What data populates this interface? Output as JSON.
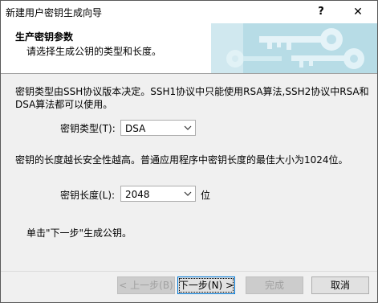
{
  "window": {
    "title": "新建用户密钥生成向导",
    "help_label": "?",
    "close_label": "✕"
  },
  "header": {
    "title": "生产密钥参数",
    "subtitle": "请选择生成公钥的类型和长度。"
  },
  "body": {
    "description_line1": "密钥类型由SSH协议版本决定。SSH1协议中只能使用RSA算法,SSH2协议中RSA和",
    "description_line2": "DSA算法都可以使用。",
    "key_type_label": "密钥类型(T):",
    "key_type_value": "DSA",
    "length_description": "密钥的长度越长安全性越高。普通应用程序中密钥长度的最佳大小为1024位。",
    "key_length_label": "密钥长度(L):",
    "key_length_value": "2048",
    "key_length_unit": "位",
    "next_instruction": "单击\"下一步\"生成公钥。"
  },
  "footer": {
    "back_label": "< 上一步(B)",
    "next_label": "下一步(N) >",
    "finish_label": "完成",
    "cancel_label": "取消"
  },
  "colors": {
    "banner": "#bfe0ea",
    "key_tint": "#e8f4f8",
    "accent": "#0078d7"
  }
}
